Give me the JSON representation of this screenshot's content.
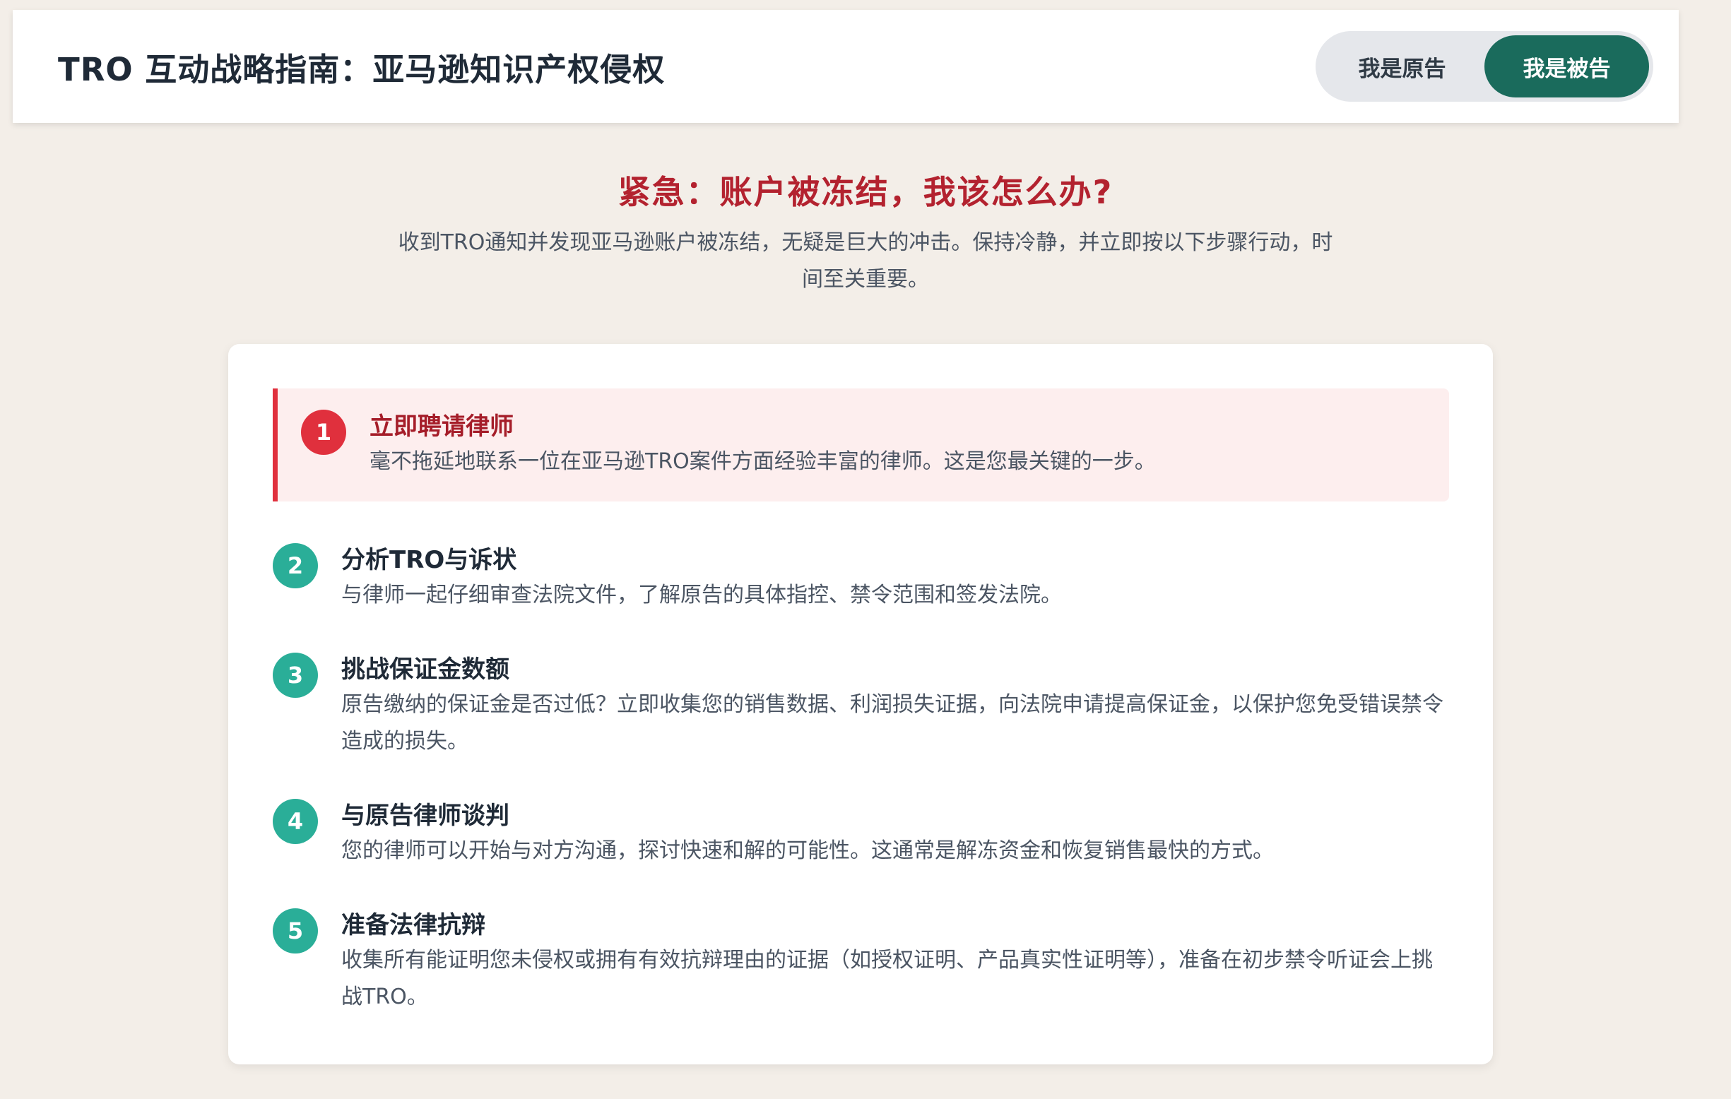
{
  "header": {
    "title": "TRO 互动战略指南：亚马逊知识产权侵权",
    "toggle": {
      "plaintiff_label": "我是原告",
      "defendant_label": "我是被告",
      "active": "defendant"
    }
  },
  "hero": {
    "title": "紧急：账户被冻结，我该怎么办?",
    "description": "收到TRO通知并发现亚马逊账户被冻结，无疑是巨大的冲击。保持冷静，并立即按以下步骤行动，时间至关重要。"
  },
  "steps": [
    {
      "number": "1",
      "title": "立即聘请律师",
      "description": "毫不拖延地联系一位在亚马逊TRO案件方面经验丰富的律师。这是您最关键的一步。"
    },
    {
      "number": "2",
      "title": "分析TRO与诉状",
      "description": "与律师一起仔细审查法院文件，了解原告的具体指控、禁令范围和签发法院。"
    },
    {
      "number": "3",
      "title": "挑战保证金数额",
      "description": "原告缴纳的保证金是否过低？立即收集您的销售数据、利润损失证据，向法院申请提高保证金，以保护您免受错误禁令造成的损失。"
    },
    {
      "number": "4",
      "title": "与原告律师谈判",
      "description": "您的律师可以开始与对方沟通，探讨快速和解的可能性。这通常是解冻资金和恢复销售最快的方式。"
    },
    {
      "number": "5",
      "title": "准备法律抗辩",
      "description": "收集所有能证明您未侵权或拥有有效抗辩理由的证据（如授权证明、产品真实性证明等），准备在初步禁令听证会上挑战TRO。"
    }
  ],
  "colors": {
    "accent": "#1a6b5c",
    "urgent": "#e0303d",
    "step_badge": "#2aae98",
    "hero_title": "#b3222f"
  }
}
